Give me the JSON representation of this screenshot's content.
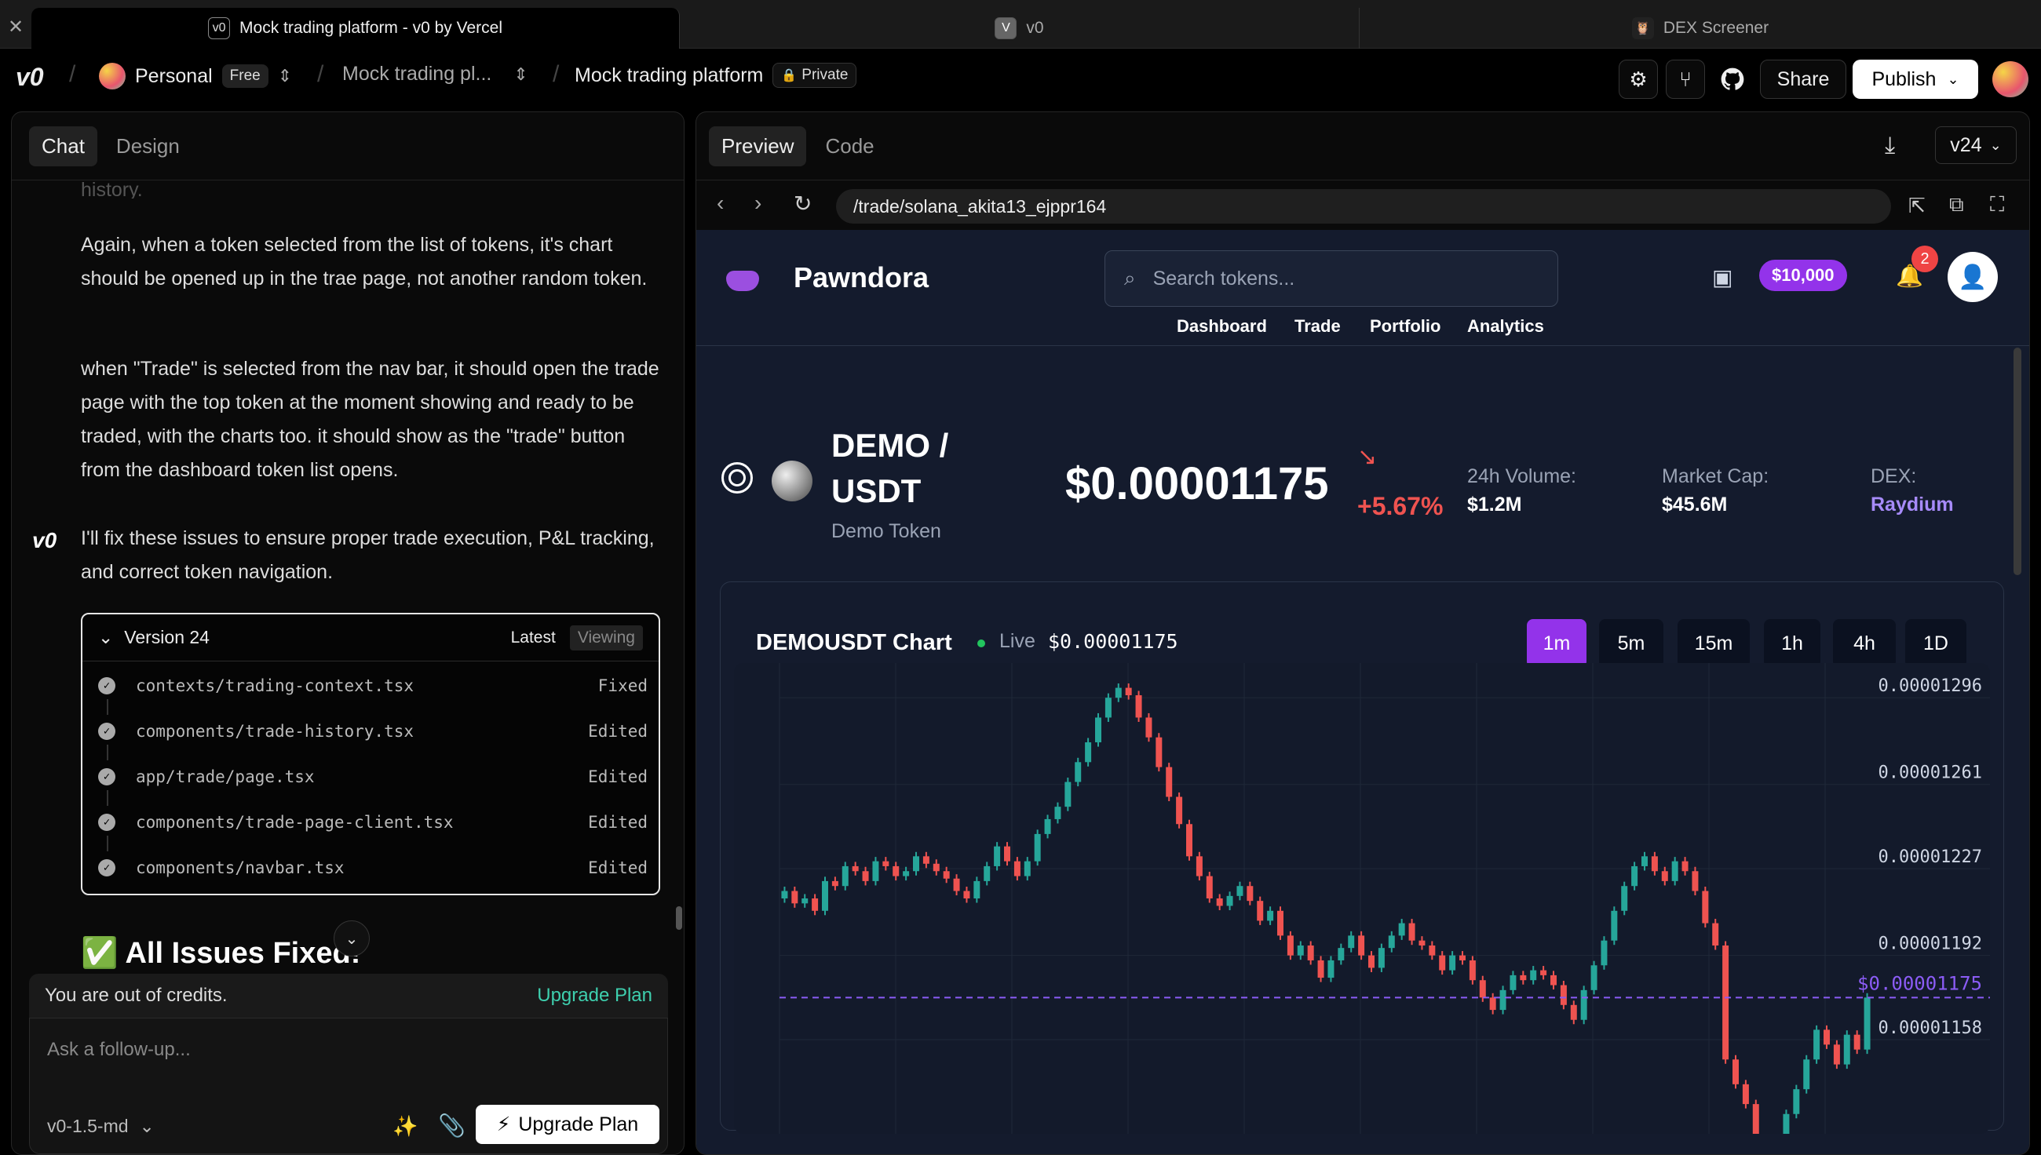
{
  "browser_tabs": [
    {
      "title": "Mock trading platform - v0 by Vercel",
      "active": true
    },
    {
      "title": "v0",
      "active": false
    },
    {
      "title": "DEX Screener",
      "active": false
    }
  ],
  "topbar": {
    "logo": "v0",
    "workspace": "Personal",
    "plan_badge": "Free",
    "project": "Mock trading pl...",
    "chat_title": "Mock trading platform",
    "visibility": "Private",
    "share_label": "Share",
    "publish_label": "Publish"
  },
  "left": {
    "tabs": [
      "Chat",
      "Design"
    ],
    "faded_text": "history.",
    "messages": [
      "Again, when a token selected from the list of tokens, it's chart should be opened up in the trae page, not another random token.",
      "when \"Trade\" is selected from the nav bar, it should open the trade page with the top token at the moment showing and ready to be traded, with the charts too. it should show as the \"trade\" button from the dashboard token list opens.",
      "I'll fix these issues to ensure proper trade execution, P&L tracking, and correct token navigation."
    ],
    "version": {
      "title": "Version 24",
      "latest": "Latest",
      "viewing": "Viewing",
      "files": [
        {
          "name": "contexts/trading-context.tsx",
          "status": "Fixed"
        },
        {
          "name": "components/trade-history.tsx",
          "status": "Edited"
        },
        {
          "name": "app/trade/page.tsx",
          "status": "Edited"
        },
        {
          "name": "components/trade-page-client.tsx",
          "status": "Edited"
        },
        {
          "name": "components/navbar.tsx",
          "status": "Edited"
        }
      ]
    },
    "fixed_heading": "✅ All Issues Fixed!",
    "credits_text": "You are out of credits.",
    "upgrade_link": "Upgrade Plan",
    "input_placeholder": "Ask a follow-up...",
    "model": "v0-1.5-md",
    "upgrade_button": "Upgrade Plan"
  },
  "right": {
    "tabs": [
      "Preview",
      "Code"
    ],
    "version": "v24",
    "url": "/trade/solana_akita13_ejppr164"
  },
  "app": {
    "brand": "Pawndora",
    "search_placeholder": "Search tokens...",
    "balance": "$10,000",
    "notif_count": "2",
    "nav": [
      "Dashboard",
      "Trade",
      "Portfolio",
      "Analytics"
    ],
    "pair_line1": "DEMO /",
    "pair_line2": "USDT",
    "token_name": "Demo Token",
    "price": "$0.00001175",
    "change": "+5.67%",
    "stats": [
      {
        "label": "24h Volume:",
        "value": "$1.2M"
      },
      {
        "label": "Market Cap:",
        "value": "$45.6M"
      },
      {
        "label": "DEX:",
        "value": "Raydium"
      }
    ],
    "chart_title": "DEMOUSDT Chart",
    "live_label": "Live",
    "live_price": "$0.00001175",
    "timeframes": [
      "1m",
      "5m",
      "15m",
      "1h",
      "4h",
      "1D"
    ],
    "active_timeframe": "1m"
  },
  "chart_data": {
    "type": "candlestick",
    "y_ticks": [
      "0.00001296",
      "0.00001261",
      "0.00001227",
      "0.00001192",
      "0.00001158"
    ],
    "current_price_label": "$0.00001175",
    "current_price": 1.175e-05,
    "ylim": [
      1.12e-05,
      1.31e-05
    ],
    "closes": [
      1.218e-05,
      1.213e-05,
      1.215e-05,
      1.21e-05,
      1.222e-05,
      1.22e-05,
      1.228e-05,
      1.226e-05,
      1.222e-05,
      1.23e-05,
      1.228e-05,
      1.224e-05,
      1.226e-05,
      1.232e-05,
      1.229e-05,
      1.226e-05,
      1.223e-05,
      1.218e-05,
      1.215e-05,
      1.222e-05,
      1.228e-05,
      1.236e-05,
      1.23e-05,
      1.224e-05,
      1.23e-05,
      1.241e-05,
      1.247e-05,
      1.252e-05,
      1.262e-05,
      1.27e-05,
      1.278e-05,
      1.288e-05,
      1.296e-05,
      1.3e-05,
      1.297e-05,
      1.288e-05,
      1.28e-05,
      1.268e-05,
      1.256e-05,
      1.245e-05,
      1.232e-05,
      1.224e-05,
      1.215e-05,
      1.212e-05,
      1.216e-05,
      1.22e-05,
      1.214e-05,
      1.206e-05,
      1.21e-05,
      1.2e-05,
      1.192e-05,
      1.196e-05,
      1.19e-05,
      1.183e-05,
      1.19e-05,
      1.195e-05,
      1.2e-05,
      1.192e-05,
      1.187e-05,
      1.195e-05,
      1.2e-05,
      1.205e-05,
      1.198e-05,
      1.196e-05,
      1.192e-05,
      1.186e-05,
      1.192e-05,
      1.19e-05,
      1.182e-05,
      1.175e-05,
      1.17e-05,
      1.178e-05,
      1.184e-05,
      1.182e-05,
      1.186e-05,
      1.184e-05,
      1.18e-05,
      1.172e-05,
      1.166e-05,
      1.178e-05,
      1.188e-05,
      1.198e-05,
      1.21e-05,
      1.22e-05,
      1.228e-05,
      1.232e-05,
      1.226e-05,
      1.222e-05,
      1.23e-05,
      1.226e-05,
      1.218e-05,
      1.205e-05,
      1.196e-05,
      1.15e-05,
      1.14e-05,
      1.132e-05,
      1.118e-05,
      1.106e-05,
      1.118e-05,
      1.128e-05,
      1.138e-05,
      1.15e-05,
      1.162e-05,
      1.156e-05,
      1.148e-05,
      1.16e-05,
      1.154e-05,
      1.175e-05
    ]
  },
  "colors": {
    "up": "#26a69a",
    "down": "#ef5350",
    "accent": "#9333ea",
    "price_line": "#8b5cf6",
    "app_bg": "#141b2d",
    "negative": "#ef5350",
    "link": "#a78bfa"
  }
}
